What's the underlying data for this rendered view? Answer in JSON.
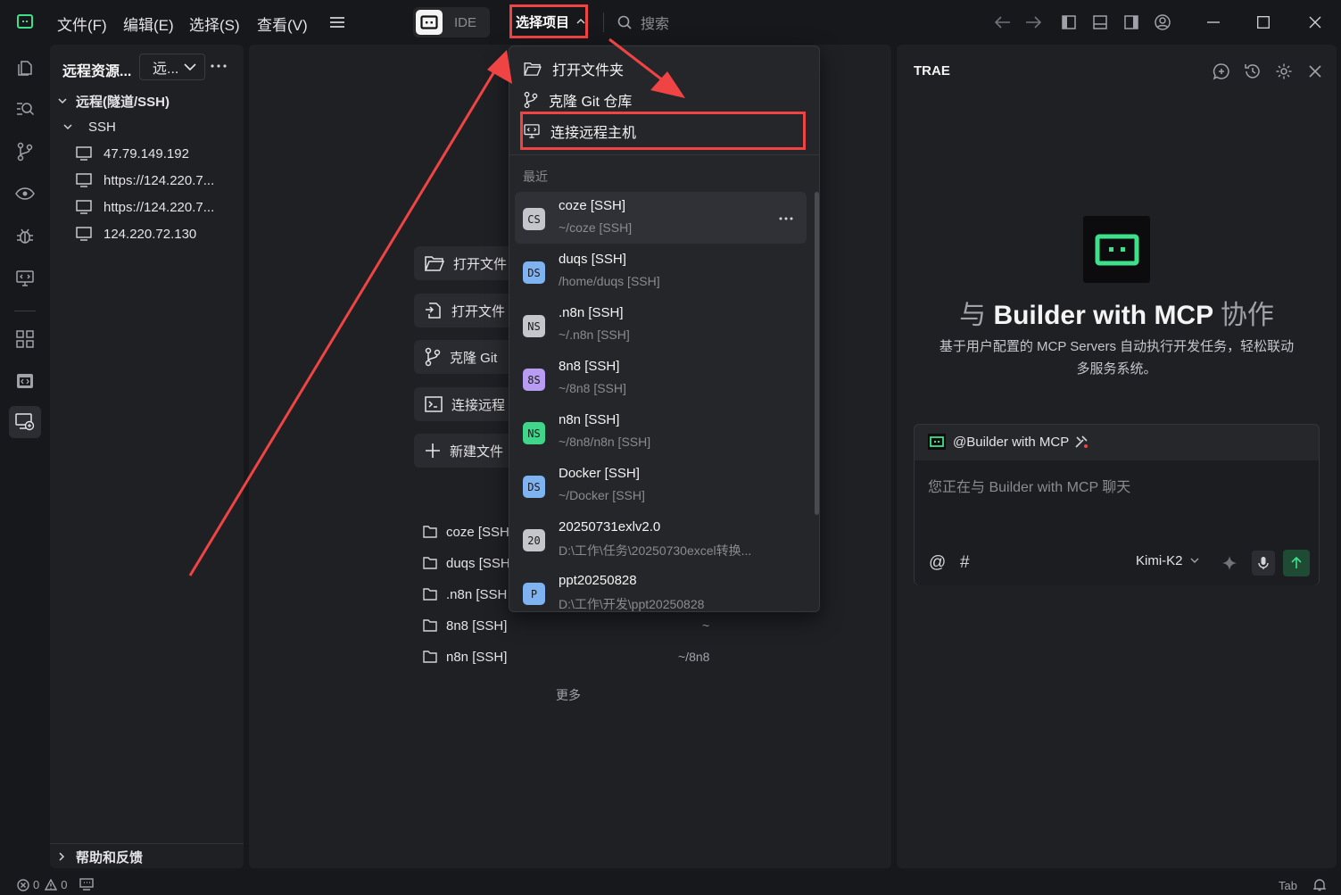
{
  "titlebar": {
    "menu": [
      "文件(F)",
      "编辑(E)",
      "选择(S)",
      "查看(V)"
    ],
    "mode_label": "IDE",
    "project_selector": "选择项目",
    "search_placeholder": "搜索"
  },
  "sidebar": {
    "title": "远程资源...",
    "filter_label": "远...",
    "section_title": "远程(隧道/SSH)",
    "group_label": "SSH",
    "hosts": [
      "47.79.149.192",
      "https://124.220.7...",
      "https://124.220.7...",
      "124.220.72.130"
    ],
    "footer_label": "帮助和反馈"
  },
  "editor": {
    "start_actions": [
      "打开文件",
      "打开文件",
      "克隆 Git",
      "连接远程",
      "新建文件"
    ],
    "recent": [
      {
        "name": "coze [SSH",
        "path": ""
      },
      {
        "name": "duqs [SSH",
        "path": ""
      },
      {
        "name": ".n8n [SSH",
        "path": ""
      },
      {
        "name": "8n8 [SSH]",
        "path": "~"
      },
      {
        "name": "n8n [SSH]",
        "path": "~/8n8"
      }
    ],
    "more_label": "更多"
  },
  "dropdown": {
    "actions": [
      "打开文件夹",
      "克隆 Git 仓库",
      "连接远程主机"
    ],
    "recent_header": "最近",
    "projects": [
      {
        "badge": "CS",
        "name": "coze [SSH]",
        "sub": "~/coze [SSH]",
        "color": "#c4c6cc"
      },
      {
        "badge": "DS",
        "name": "duqs [SSH]",
        "sub": "/home/duqs [SSH]",
        "color": "#7fb2f0"
      },
      {
        "badge": "NS",
        "name": ".n8n [SSH]",
        "sub": "~/.n8n [SSH]",
        "color": "#c4c6cc"
      },
      {
        "badge": "8S",
        "name": "8n8 [SSH]",
        "sub": "~/8n8 [SSH]",
        "color": "#b79cf2"
      },
      {
        "badge": "NS",
        "name": "n8n [SSH]",
        "sub": "~/8n8/n8n [SSH]",
        "color": "#3fd68a"
      },
      {
        "badge": "DS",
        "name": "Docker [SSH]",
        "sub": "~/Docker [SSH]",
        "color": "#7fb2f0"
      },
      {
        "badge": "20",
        "name": "20250731exlv2.0",
        "sub": "D:\\工作\\任务\\20250730excel转换...",
        "color": "#c4c6cc"
      },
      {
        "badge": "P",
        "name": "ppt20250828",
        "sub": "D:\\工作\\开发\\ppt20250828",
        "color": "#7fb2f0"
      }
    ]
  },
  "right_panel": {
    "title": "TRAE",
    "hero_prefix": "与",
    "hero_main": "Builder with MCP",
    "hero_suffix": "协作",
    "description": "基于用户配置的 MCP Servers 自动执行开发任务，轻松联动多服务系统。",
    "agent_label": "@Builder with MCP",
    "chat_placeholder": "您正在与 Builder with MCP 聊天",
    "model_label": "Kimi-K2"
  },
  "statusbar": {
    "errors": "0",
    "warnings": "0",
    "tab_label": "Tab"
  },
  "colors": {
    "accent_green": "#3ee08a",
    "highlight_red": "#f04444",
    "background": "#17181c",
    "panel": "#1f2024"
  }
}
